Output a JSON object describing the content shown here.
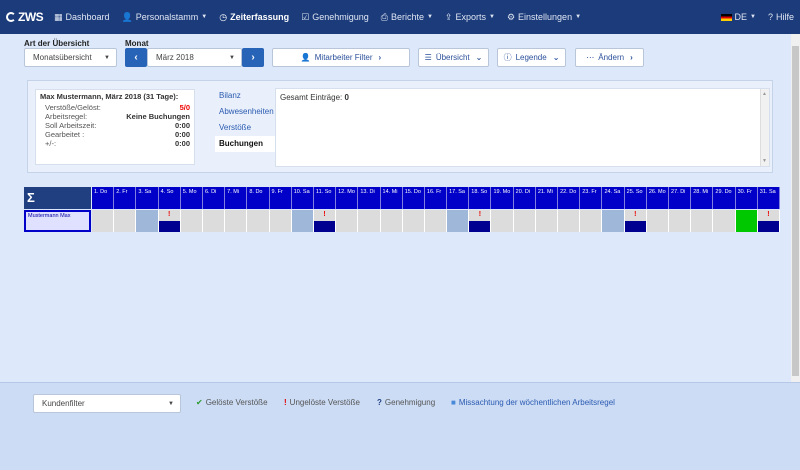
{
  "nav": {
    "logo": "ZWS",
    "items": [
      {
        "label": "Dashboard",
        "icon": "grid-icon",
        "glyph": "▦",
        "dropdown": false,
        "active": false
      },
      {
        "label": "Personalstamm",
        "icon": "user-icon",
        "glyph": "👤",
        "dropdown": true,
        "active": false
      },
      {
        "label": "Zeiterfassung",
        "icon": "clock-icon",
        "glyph": "◷",
        "dropdown": false,
        "active": true
      },
      {
        "label": "Genehmigung",
        "icon": "check-icon",
        "glyph": "☑",
        "dropdown": false,
        "active": false
      },
      {
        "label": "Berichte",
        "icon": "print-icon",
        "glyph": "⎙",
        "dropdown": true,
        "active": false
      },
      {
        "label": "Exports",
        "icon": "export-icon",
        "glyph": "⇪",
        "dropdown": true,
        "active": false
      },
      {
        "label": "Einstellungen",
        "icon": "gear-icon",
        "glyph": "⚙",
        "dropdown": true,
        "active": false
      }
    ],
    "language": "DE",
    "help": "Hilfe"
  },
  "toolbar": {
    "overview_label": "Art der Übersicht",
    "overview_value": "Monatsübersicht",
    "month_label": "Monat",
    "month_value": "März 2018",
    "employee_filter": "Mitarbeiter Filter",
    "overview_btn": "Übersicht",
    "legend_btn": "Legende",
    "change_btn": "Ändern"
  },
  "summary": {
    "title": "Max Mustermann, März 2018 (31 Tage):",
    "rows": [
      {
        "label": "Verstöße/Gelöst:",
        "value": "5/0",
        "red": true
      },
      {
        "label": "Arbeitsregel:",
        "value": "Keine Buchungen",
        "red": false
      },
      {
        "label": "Soll Arbeitszeit:",
        "value": "0:00",
        "red": false
      },
      {
        "label": "Gearbeitet :",
        "value": "0:00",
        "red": false
      },
      {
        "label": "+/-:",
        "value": "0:00",
        "red": false
      }
    ]
  },
  "tabs": [
    "Bilanz",
    "Abwesenheiten",
    "Verstöße",
    "Buchungen"
  ],
  "active_tab": 3,
  "detail": {
    "label": "Gesamt Einträge:",
    "value": "0"
  },
  "calendar": {
    "sigma": "Σ",
    "employee": "Mustermann Max",
    "days": [
      "1. Do",
      "2. Fr",
      "3. Sa",
      "4. So",
      "5. Mo",
      "6. Di",
      "7. Mi",
      "8. Do",
      "9. Fr",
      "10. Sa",
      "11. So",
      "12. Mo",
      "13. Di",
      "14. Mi",
      "15. Do",
      "16. Fr",
      "17. Sa",
      "18. So",
      "19. Mo",
      "20. Di",
      "21. Mi",
      "22. Do",
      "23. Fr",
      "24. Sa",
      "25. So",
      "26. Mo",
      "27. Di",
      "28. Mi",
      "29. Do",
      "30. Fr",
      "31. Sa"
    ],
    "cells": [
      "n",
      "n",
      "we",
      "viol",
      "n",
      "n",
      "n",
      "n",
      "n",
      "we",
      "viol",
      "n",
      "n",
      "n",
      "n",
      "n",
      "we",
      "viol",
      "n",
      "n",
      "n",
      "n",
      "n",
      "we",
      "viol",
      "n",
      "n",
      "n",
      "n",
      "green",
      "viol"
    ]
  },
  "footer": {
    "filter_placeholder": "Kundenfilter",
    "legend": [
      {
        "symbol": "✔",
        "color": "#2a9a2a",
        "label": "Gelöste Verstöße"
      },
      {
        "symbol": "!",
        "color": "#e00000",
        "label": "Ungelöste Verstöße"
      },
      {
        "symbol": "?",
        "color": "#1f3f80",
        "label": "Genehmigung"
      },
      {
        "symbol": "■",
        "color": "#4a88d8",
        "label": "Missachtung der wöchentlichen Arbeitsregel"
      }
    ]
  }
}
